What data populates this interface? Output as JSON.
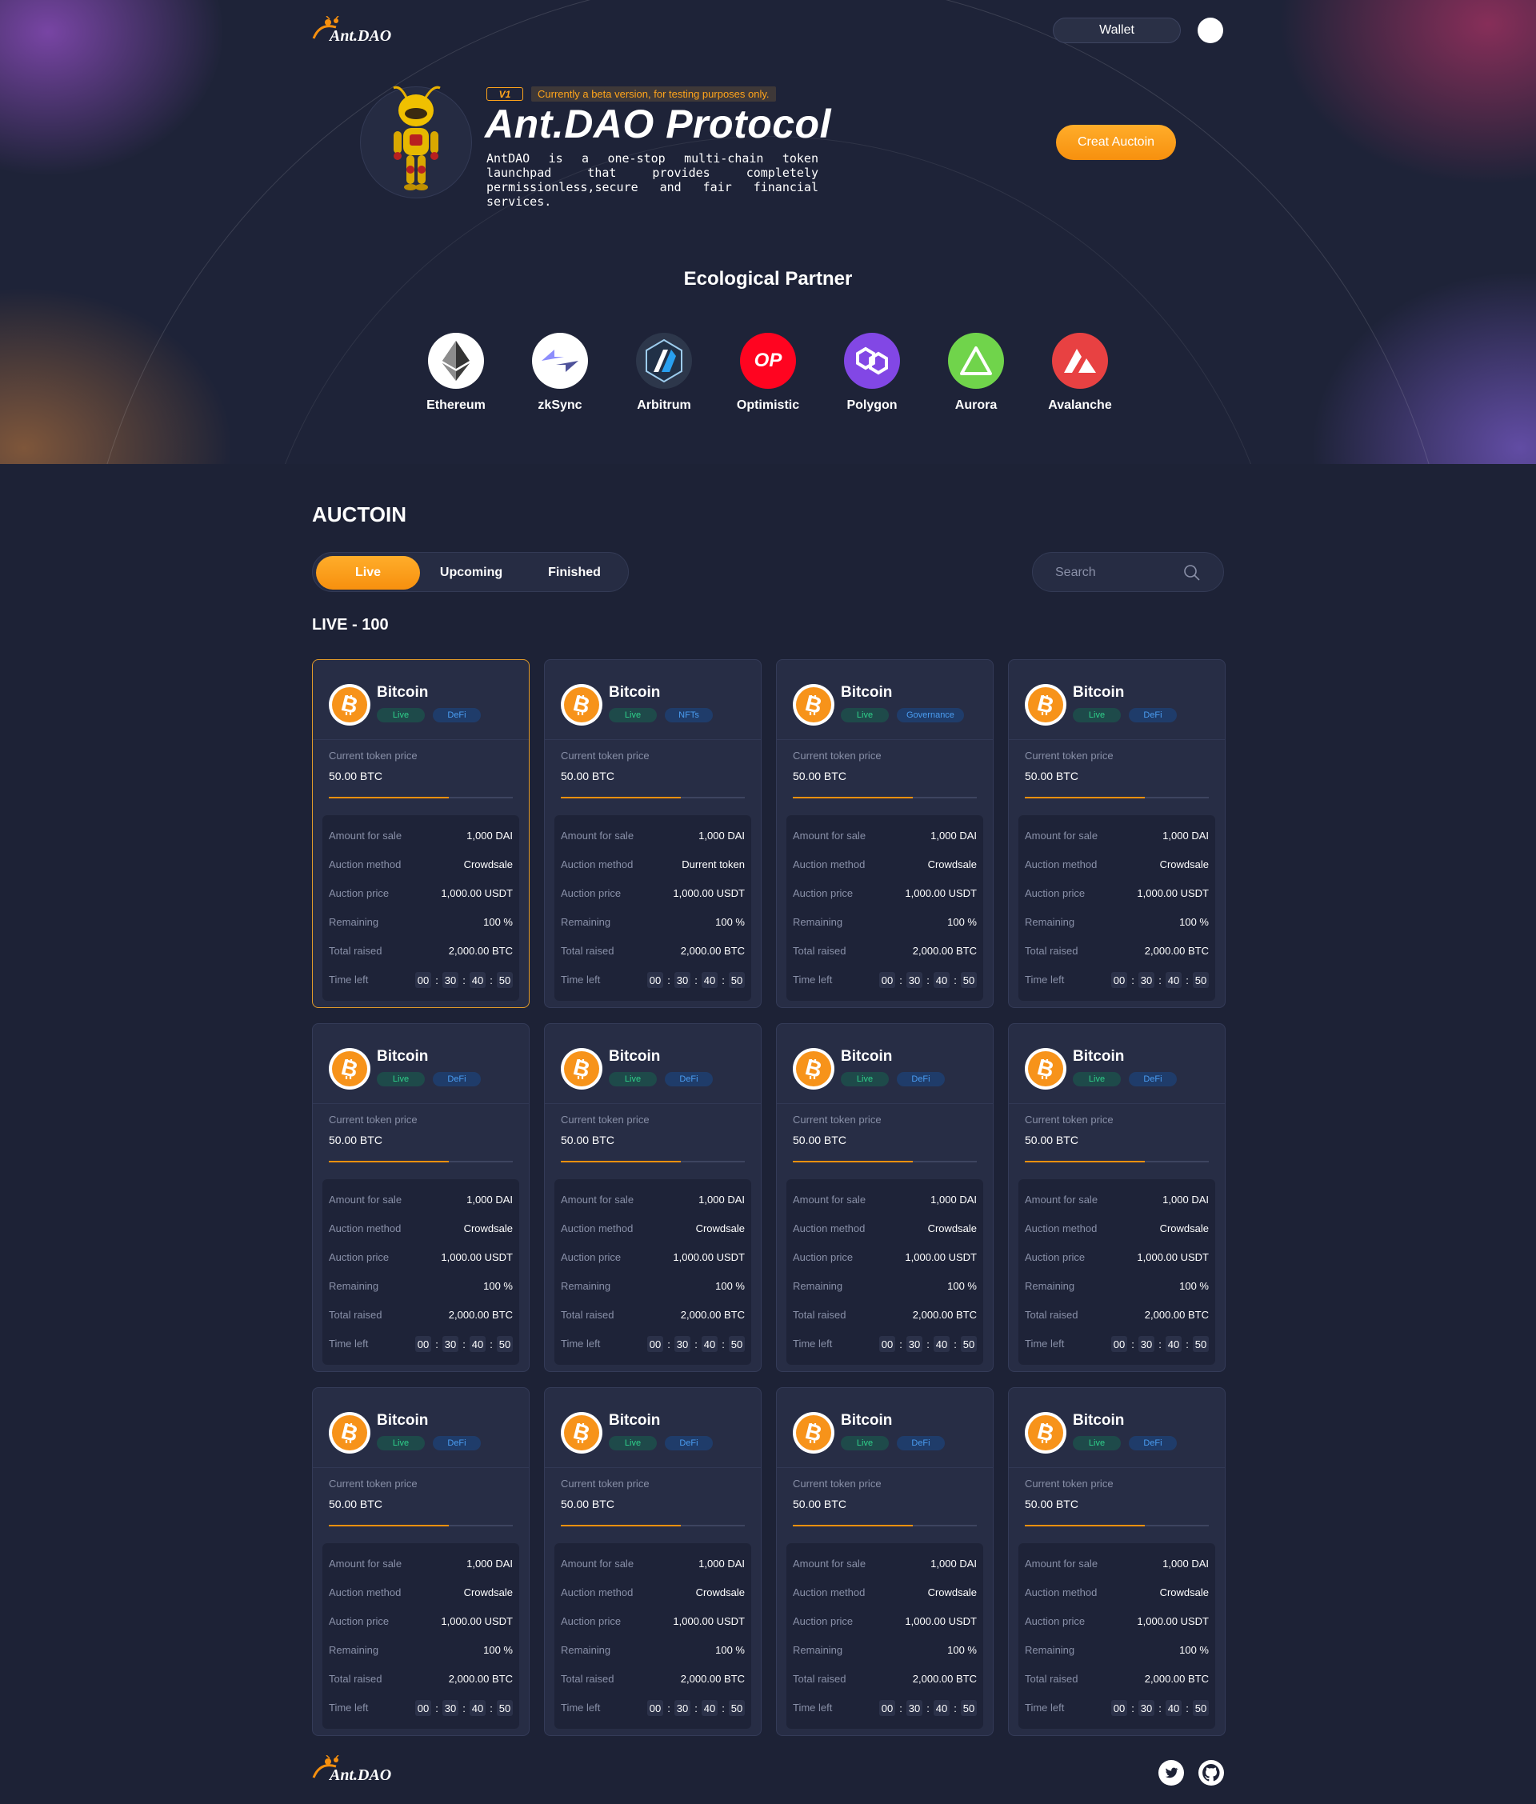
{
  "brand": {
    "name": "Ant.DAO"
  },
  "header": {
    "wallet_label": "Wallet"
  },
  "hero": {
    "version_badge": "V1",
    "beta_note": "Currently a beta version, for testing purposes only.",
    "title": "Ant.DAO Protocol",
    "description": "AntDAO is a one-stop multi-chain token launchpad that provides completely permissionless,secure and fair financial services.",
    "create_button": "Creat Auctoin"
  },
  "partners": {
    "title": "Ecological Partner",
    "items": [
      {
        "name": "Ethereum",
        "icon": "ethereum-icon",
        "color": "#ffffff"
      },
      {
        "name": "zkSync",
        "icon": "zksync-icon",
        "color": "#ffffff"
      },
      {
        "name": "Arbitrum",
        "icon": "arbitrum-icon",
        "color": "#2d374b"
      },
      {
        "name": "Optimistic",
        "icon": "optimism-icon",
        "color": "#ff0420"
      },
      {
        "name": "Polygon",
        "icon": "polygon-icon",
        "color": "#8247e5"
      },
      {
        "name": "Aurora",
        "icon": "aurora-icon",
        "color": "#70d44b"
      },
      {
        "name": "Avalanche",
        "icon": "avalanche-icon",
        "color": "#e84142"
      }
    ]
  },
  "auction": {
    "title": "AUCTOIN",
    "tabs": [
      "Live",
      "Upcoming",
      "Finished"
    ],
    "active_tab": "Live",
    "search_placeholder": "Search",
    "live_count_label": "LIVE - 100",
    "labels": {
      "current_price": "Current token price",
      "amount": "Amount for sale",
      "method": "Auction method",
      "price": "Auction price",
      "remaining": "Remaining",
      "raised": "Total raised",
      "time_left": "Time left"
    },
    "cards": [
      {
        "name": "Bitcoin",
        "status": "Live",
        "category": "DeFi",
        "current_price": "50.00 BTC",
        "progress": 0.65,
        "amount": "1,000 DAI",
        "method": "Crowdsale",
        "price": "1,000.00 USDT",
        "remaining": "100 %",
        "raised": "2,000.00 BTC",
        "time": [
          "00",
          "30",
          "40",
          "50"
        ]
      },
      {
        "name": "Bitcoin",
        "status": "Live",
        "category": "NFTs",
        "current_price": "50.00 BTC",
        "progress": 0.65,
        "amount": "1,000 DAI",
        "method": "Durrent token",
        "price": "1,000.00 USDT",
        "remaining": "100 %",
        "raised": "2,000.00 BTC",
        "time": [
          "00",
          "30",
          "40",
          "50"
        ]
      },
      {
        "name": "Bitcoin",
        "status": "Live",
        "category": "Governance",
        "current_price": "50.00 BTC",
        "progress": 0.65,
        "amount": "1,000 DAI",
        "method": "Crowdsale",
        "price": "1,000.00 USDT",
        "remaining": "100 %",
        "raised": "2,000.00 BTC",
        "time": [
          "00",
          "30",
          "40",
          "50"
        ]
      },
      {
        "name": "Bitcoin",
        "status": "Live",
        "category": "DeFi",
        "current_price": "50.00 BTC",
        "progress": 0.65,
        "amount": "1,000 DAI",
        "method": "Crowdsale",
        "price": "1,000.00 USDT",
        "remaining": "100 %",
        "raised": "2,000.00 BTC",
        "time": [
          "00",
          "30",
          "40",
          "50"
        ]
      },
      {
        "name": "Bitcoin",
        "status": "Live",
        "category": "DeFi",
        "current_price": "50.00 BTC",
        "progress": 0.65,
        "amount": "1,000 DAI",
        "method": "Crowdsale",
        "price": "1,000.00 USDT",
        "remaining": "100 %",
        "raised": "2,000.00 BTC",
        "time": [
          "00",
          "30",
          "40",
          "50"
        ]
      },
      {
        "name": "Bitcoin",
        "status": "Live",
        "category": "DeFi",
        "current_price": "50.00 BTC",
        "progress": 0.65,
        "amount": "1,000 DAI",
        "method": "Crowdsale",
        "price": "1,000.00 USDT",
        "remaining": "100 %",
        "raised": "2,000.00 BTC",
        "time": [
          "00",
          "30",
          "40",
          "50"
        ]
      },
      {
        "name": "Bitcoin",
        "status": "Live",
        "category": "DeFi",
        "current_price": "50.00 BTC",
        "progress": 0.65,
        "amount": "1,000 DAI",
        "method": "Crowdsale",
        "price": "1,000.00 USDT",
        "remaining": "100 %",
        "raised": "2,000.00 BTC",
        "time": [
          "00",
          "30",
          "40",
          "50"
        ]
      },
      {
        "name": "Bitcoin",
        "status": "Live",
        "category": "DeFi",
        "current_price": "50.00 BTC",
        "progress": 0.65,
        "amount": "1,000 DAI",
        "method": "Crowdsale",
        "price": "1,000.00 USDT",
        "remaining": "100 %",
        "raised": "2,000.00 BTC",
        "time": [
          "00",
          "30",
          "40",
          "50"
        ]
      },
      {
        "name": "Bitcoin",
        "status": "Live",
        "category": "DeFi",
        "current_price": "50.00 BTC",
        "progress": 0.65,
        "amount": "1,000 DAI",
        "method": "Crowdsale",
        "price": "1,000.00 USDT",
        "remaining": "100 %",
        "raised": "2,000.00 BTC",
        "time": [
          "00",
          "30",
          "40",
          "50"
        ]
      },
      {
        "name": "Bitcoin",
        "status": "Live",
        "category": "DeFi",
        "current_price": "50.00 BTC",
        "progress": 0.65,
        "amount": "1,000 DAI",
        "method": "Crowdsale",
        "price": "1,000.00 USDT",
        "remaining": "100 %",
        "raised": "2,000.00 BTC",
        "time": [
          "00",
          "30",
          "40",
          "50"
        ]
      },
      {
        "name": "Bitcoin",
        "status": "Live",
        "category": "DeFi",
        "current_price": "50.00 BTC",
        "progress": 0.65,
        "amount": "1,000 DAI",
        "method": "Crowdsale",
        "price": "1,000.00 USDT",
        "remaining": "100 %",
        "raised": "2,000.00 BTC",
        "time": [
          "00",
          "30",
          "40",
          "50"
        ]
      },
      {
        "name": "Bitcoin",
        "status": "Live",
        "category": "DeFi",
        "current_price": "50.00 BTC",
        "progress": 0.65,
        "amount": "1,000 DAI",
        "method": "Crowdsale",
        "price": "1,000.00 USDT",
        "remaining": "100 %",
        "raised": "2,000.00 BTC",
        "time": [
          "00",
          "30",
          "40",
          "50"
        ]
      }
    ]
  },
  "footer": {
    "social": [
      "twitter-icon",
      "github-icon"
    ]
  },
  "colors": {
    "accent": "#f7900e",
    "background": "#1d2236",
    "card": "#272d45",
    "live": "#2fd08a",
    "category": "#4a9cf0"
  }
}
